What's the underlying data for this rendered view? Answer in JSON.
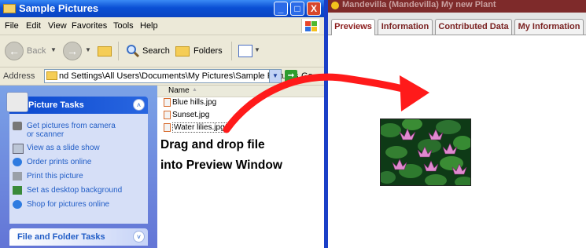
{
  "explorer": {
    "title": "Sample Pictures",
    "window_buttons": [
      "_",
      "□",
      "X"
    ],
    "menu": [
      "File",
      "Edit",
      "View",
      "Favorites",
      "Tools",
      "Help"
    ],
    "toolbar": {
      "back": "Back",
      "search": "Search",
      "folders": "Folders"
    },
    "address": {
      "label": "Address",
      "value": "nd Settings\\All Users\\Documents\\My Pictures\\Sample Pictures",
      "go": "Go"
    },
    "picture_tasks": {
      "title": "Picture Tasks",
      "items": [
        {
          "label": "Get pictures from camera",
          "label2": "or scanner",
          "icon": "camera-icon"
        },
        {
          "label": "View as a slide show",
          "icon": "slideshow-icon"
        },
        {
          "label": "Order prints online",
          "icon": "globe-icon"
        },
        {
          "label": "Print this picture",
          "icon": "printer-icon"
        },
        {
          "label": "Set as desktop background",
          "icon": "desktop-icon"
        },
        {
          "label": "Shop for pictures online",
          "icon": "globe-icon"
        }
      ]
    },
    "file_folder_tasks": {
      "title": "File and Folder Tasks"
    },
    "file_list": {
      "column": "Name",
      "files": [
        "Blue hills.jpg",
        "Sunset.jpg",
        "Water lilies.jpg"
      ],
      "selected": "Water lilies.jpg"
    }
  },
  "app": {
    "title": "Mandevilla (Mandevilla) My new Plant",
    "tabs": [
      "Previews",
      "Information",
      "Contributed Data",
      "My Information"
    ],
    "active_tab": "Previews"
  },
  "annotation": {
    "line1": "Drag and drop file",
    "line2": "into Preview Window",
    "arrow_color": "#ff1a1a"
  },
  "colors": {
    "xp_title_blue": "#0a4fd4",
    "task_pane_blue": "#6375d6",
    "app_title_maroon": "#7e2a2a",
    "tab_text": "#8b1c1c"
  }
}
